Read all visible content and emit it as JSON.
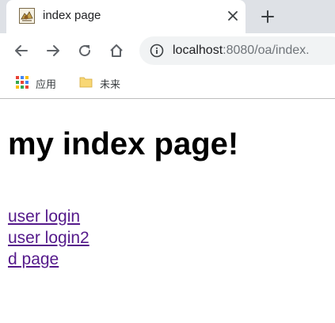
{
  "tab": {
    "title": "index page",
    "favicon": "tomcat-favicon-icon"
  },
  "toolbar": {
    "back_icon": "back-arrow-icon",
    "forward_icon": "forward-arrow-icon",
    "reload_icon": "reload-icon",
    "home_icon": "home-icon",
    "address": {
      "host": "localhost",
      "rest": ":8080/oa/index."
    }
  },
  "bookmarks": [
    {
      "label": "应用",
      "icon": "apps-grid-icon"
    },
    {
      "label": "未来",
      "icon": "folder-icon"
    }
  ],
  "page": {
    "heading": "my index page!",
    "links": [
      "user login",
      "user login2",
      "d page"
    ]
  },
  "colors": {
    "tabstrip": "#dee1e6",
    "omnibox": "#f1f3f4",
    "visited_link": "#551a8b",
    "folder": "#f8d775"
  }
}
